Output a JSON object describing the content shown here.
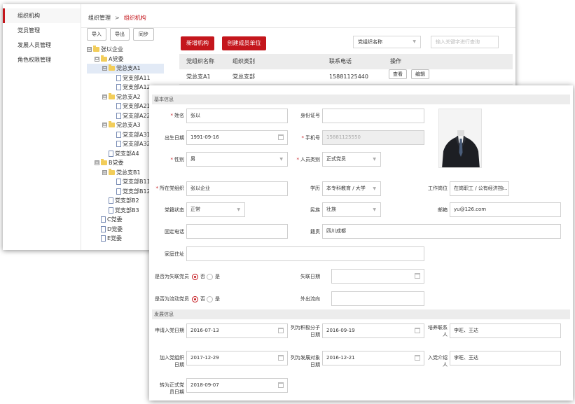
{
  "sidebar": {
    "items": [
      {
        "label": "组织机构",
        "active": true
      },
      {
        "label": "党员管理"
      },
      {
        "label": "发展人员管理"
      },
      {
        "label": "角色权限管理"
      }
    ]
  },
  "breadcrumb": {
    "root": "组织管理",
    "sep": ">",
    "current": "组织机构"
  },
  "toolbar": {
    "import": "导入",
    "export": "导出",
    "sync": "同步"
  },
  "tree": {
    "nodes": [
      {
        "label": "张以企业",
        "level": 0,
        "type": "folder",
        "toggle": "⊟"
      },
      {
        "label": "A党委",
        "level": 1,
        "type": "folder",
        "toggle": "⊟"
      },
      {
        "label": "党总支A1",
        "level": 2,
        "type": "folder",
        "toggle": "⊟",
        "selected": true
      },
      {
        "label": "党支部A11",
        "level": 3,
        "type": "doc"
      },
      {
        "label": "党支部A12",
        "level": 3,
        "type": "doc"
      },
      {
        "label": "党总支A2",
        "level": 2,
        "type": "folder",
        "toggle": "⊟"
      },
      {
        "label": "党支部A21",
        "level": 3,
        "type": "doc"
      },
      {
        "label": "党支部A22",
        "level": 3,
        "type": "doc"
      },
      {
        "label": "党总支A3",
        "level": 2,
        "type": "folder",
        "toggle": "⊟"
      },
      {
        "label": "党支部A31",
        "level": 3,
        "type": "doc"
      },
      {
        "label": "党支部A32",
        "level": 3,
        "type": "doc"
      },
      {
        "label": "党支部A4",
        "level": 2,
        "type": "doc"
      },
      {
        "label": "B党委",
        "level": 1,
        "type": "folder",
        "toggle": "⊟"
      },
      {
        "label": "党总支B1",
        "level": 2,
        "type": "folder",
        "toggle": "⊟"
      },
      {
        "label": "党支部B11",
        "level": 3,
        "type": "doc"
      },
      {
        "label": "党支部B12",
        "level": 3,
        "type": "doc"
      },
      {
        "label": "党支部B2",
        "level": 2,
        "type": "doc"
      },
      {
        "label": "党支部B3",
        "level": 2,
        "type": "doc"
      },
      {
        "label": "C党委",
        "level": 1,
        "type": "doc"
      },
      {
        "label": "D党委",
        "level": 1,
        "type": "doc"
      },
      {
        "label": "E党委",
        "level": 1,
        "type": "doc"
      }
    ]
  },
  "actions": {
    "new_org": "新增机构",
    "create_member_unit": "创建成员单位"
  },
  "filter": {
    "select_value": "党组织名称",
    "keyword_placeholder": "输入关键字进行查询"
  },
  "table": {
    "headers": [
      "党组织名称",
      "组织类别",
      "联系电话",
      "操作"
    ],
    "rows": [
      {
        "name": "党总支A1",
        "category": "党总支部",
        "phone": "15881125440",
        "ops": [
          "查看",
          "编辑"
        ]
      }
    ]
  },
  "form": {
    "section_basic": "基本信息",
    "name": {
      "label": "姓名",
      "value": "张以",
      "required": true
    },
    "id_card": {
      "label": "身份证号",
      "value": ""
    },
    "birth": {
      "label": "出生日期",
      "value": "1991-09-16"
    },
    "phone": {
      "label": "手机号",
      "value": "15881125550",
      "required": true
    },
    "gender": {
      "label": "性别",
      "value": "男",
      "required": true
    },
    "person_type": {
      "label": "人员类别",
      "value": "正式党员",
      "required": true
    },
    "org": {
      "label": "所在党组织",
      "value": "张以企业",
      "required": true
    },
    "education": {
      "label": "学历",
      "value": "本专科教育 / 大学"
    },
    "job": {
      "label": "工作岗位",
      "value": "在岗职工 / 公有经济控..."
    },
    "status": {
      "label": "党籍状态",
      "value": "正常"
    },
    "ethnic": {
      "label": "民族",
      "value": "壮族"
    },
    "email": {
      "label": "邮箱",
      "value": "yu@126.com"
    },
    "tel": {
      "label": "固定电话",
      "value": ""
    },
    "native": {
      "label": "籍贯",
      "value": "四川成都"
    },
    "address": {
      "label": "家庭住址",
      "value": ""
    },
    "lost": {
      "label": "是否为失联党员",
      "yes": "是",
      "no": "否"
    },
    "lost_date": {
      "label": "失联日期",
      "value": ""
    },
    "mobile": {
      "label": "是否为流动党员",
      "yes": "是",
      "no": "否"
    },
    "outflow": {
      "label": "外出流向",
      "value": ""
    },
    "section_dev": "发展信息",
    "apply_date": {
      "label": "申请入党日期",
      "value": "2016-07-13"
    },
    "activist_date": {
      "label": "列为积极分子日期",
      "value": "2016-09-19"
    },
    "contact": {
      "label": "培养联系人",
      "value": "李旺、王达"
    },
    "join_date": {
      "label": "加入党组织日期",
      "value": "2017-12-29"
    },
    "target_date": {
      "label": "列为发展对象日期",
      "value": "2016-12-21"
    },
    "introducer": {
      "label": "入党介绍人",
      "value": "李旺、王达"
    },
    "formal_date": {
      "label": "转为正式党员日期",
      "value": "2018-09-07"
    }
  },
  "colors": {
    "accent": "#c4161c",
    "header_bg": "#ececec"
  }
}
